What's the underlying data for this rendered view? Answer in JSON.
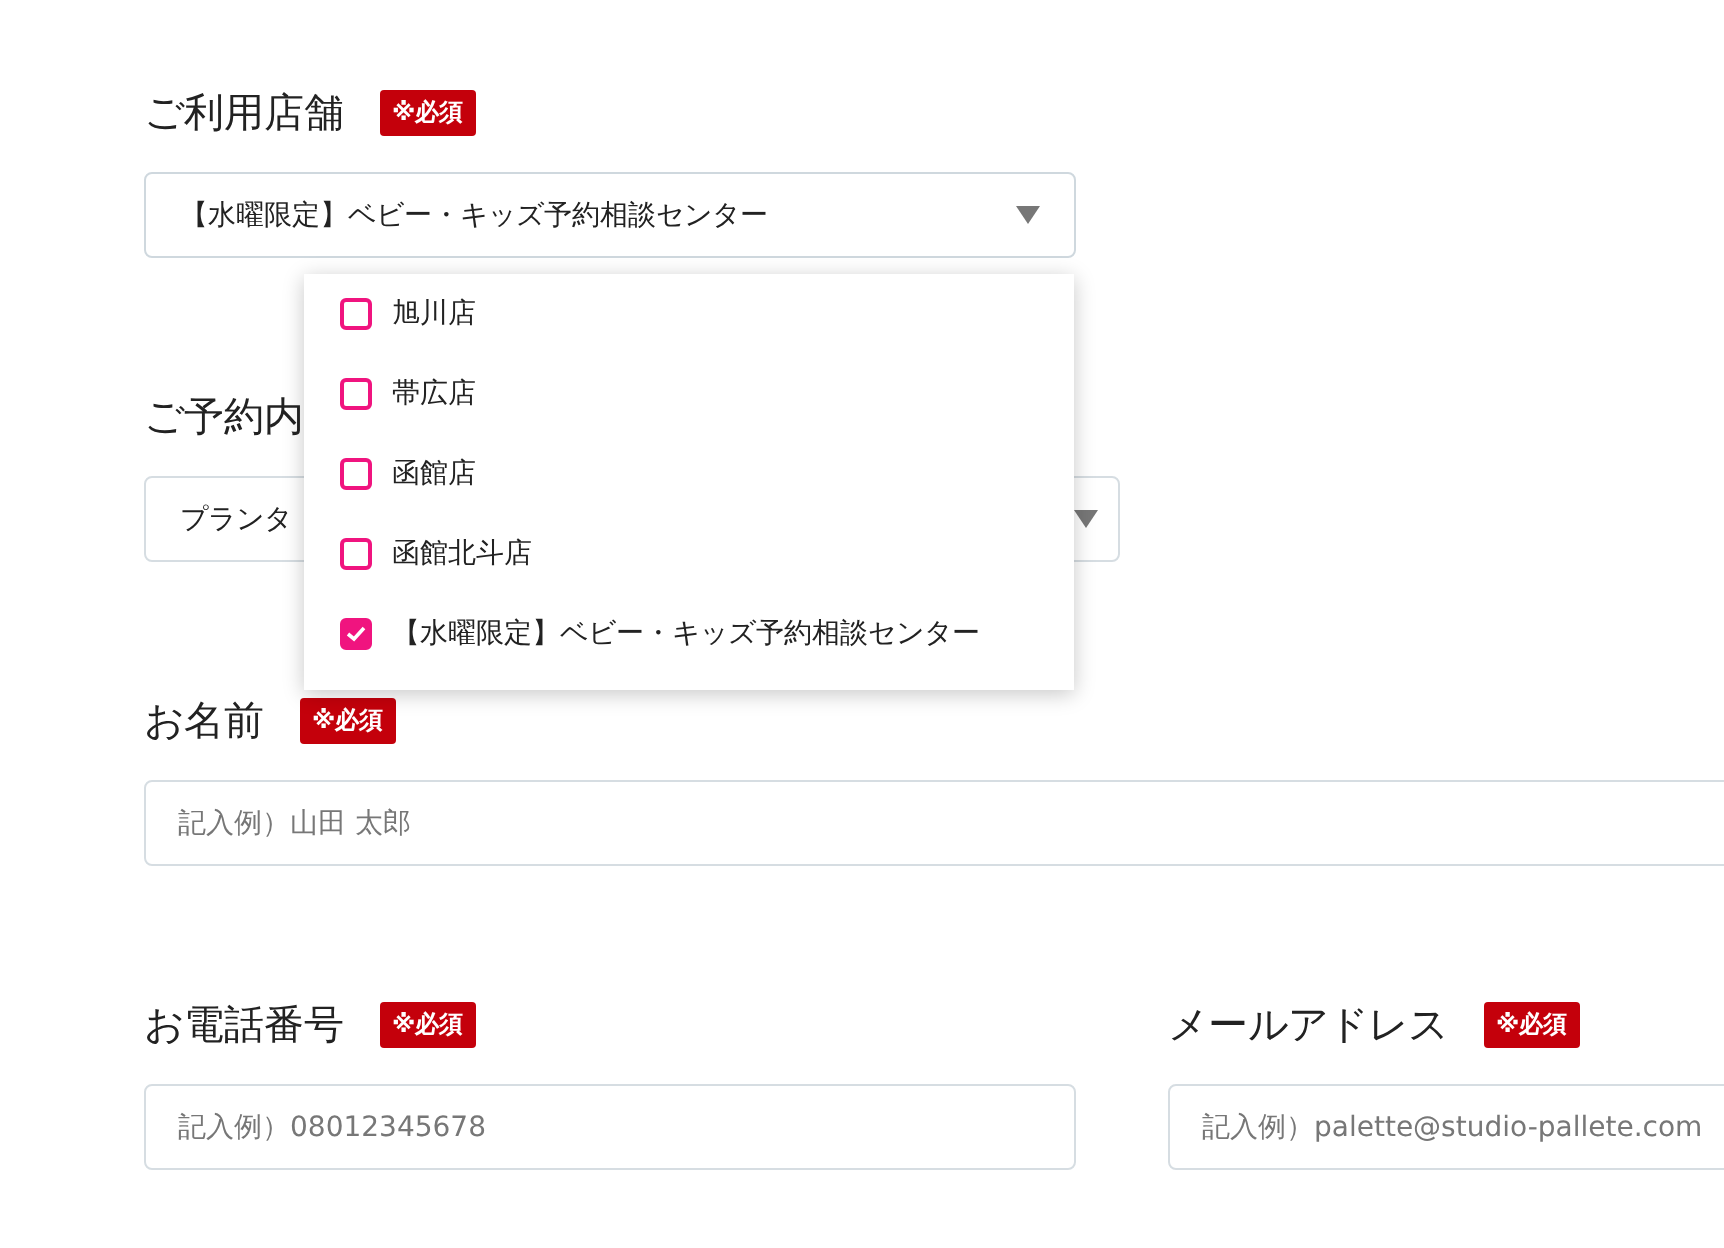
{
  "rows": [
    [
      {
        "kind": "select",
        "label": "ご利用店舗",
        "badge": "※必須",
        "value": "【水曜限定】ベビー・キッズ予約相談センター",
        "expanded": true,
        "options": [
          {
            "label": "旭川店",
            "checked": false
          },
          {
            "label": "帯広店",
            "checked": false
          },
          {
            "label": "函館店",
            "checked": false
          },
          {
            "label": "函館北斗店",
            "checked": false
          },
          {
            "label": "【水曜限定】ベビー・キッズ予約相談センター",
            "checked": true
          }
        ]
      }
    ],
    [
      {
        "kind": "select",
        "label": "ご予約内",
        "value": "プランタ"
      }
    ],
    [
      {
        "kind": "text",
        "label": "お名前",
        "badge": "※必須",
        "placeholder": "記入例）山田 太郎"
      }
    ],
    [
      {
        "kind": "text",
        "label": "お電話番号",
        "badge": "※必須",
        "placeholder": "記入例）08012345678"
      },
      {
        "kind": "text",
        "label": "メールアドレス",
        "badge": "※必須",
        "placeholder": "記入例）palette@studio-pallete.com"
      }
    ]
  ]
}
